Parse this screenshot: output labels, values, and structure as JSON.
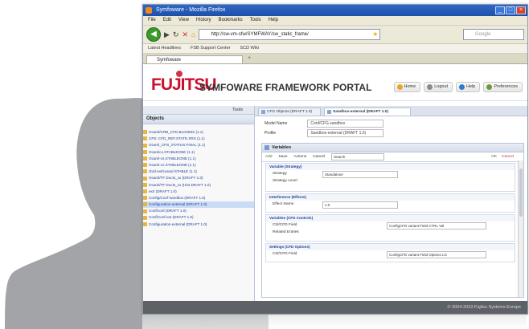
{
  "browser": {
    "title": "Symfoware - Mozilla Firefox",
    "menu": [
      "File",
      "Edit",
      "View",
      "History",
      "Bookmarks",
      "Tools",
      "Help"
    ],
    "url": "http://sw-vm-sfw/SYMFWAY/sw_static_frame/",
    "search_placeholder": "Google",
    "bookmarks": [
      "Latest Headlines",
      "FSB Support Center",
      "SCD Wiki"
    ],
    "tab_label": "Symfoware",
    "new_tab": "+"
  },
  "header": {
    "logo_text": "FUJITSU",
    "portal_title": "SYMFOWARE FRAMEWORK PORTAL",
    "actions": [
      "Home",
      "Logout",
      "Help",
      "Preferences"
    ],
    "action_colors": [
      "#e6a824",
      "#8a8a8a",
      "#2e7bd1",
      "#6a9a3a"
    ]
  },
  "left": {
    "head": "Tools",
    "section": "Objects",
    "tree": [
      "Ocaml/CRB_CFD.BLOOMS (1.1)",
      "CPS: CFD_REF.STATE.SRS (1.1)",
      "Ocaml_CPS_STATUS.FINAL (1.1)",
      "Ocamlcx.STABLEONE (1.1)",
      "Ocaml-cs.STABLEONE (1.1)",
      "Ocaml-cx.STABLEONE (1.1)",
      "cb/d-ext/cusval STABLE (1.1)",
      "Ocaml/TF Ducts_cx (DRAFT 1.0)",
      "Ocaml/TF Ducts_cx (Hint DRAFT 1.0)",
      "ext/ (DRAFT 1.0)",
      "Config/Conf-sandbox (DRAFT 1.0)",
      "Configuration-external (DRAFT 1.0)",
      "Conf/conf (DRAFT 1.0)",
      "Conf/Conf-ext (DRAFT 1.0)",
      "Configuration-external (DRAFT 1.0)"
    ],
    "selected_index": 11
  },
  "main": {
    "tabs": [
      "CFG Objects (DRAFT 1.0)",
      "Sandbox-external (DRAFT 1.0)"
    ],
    "fields": [
      {
        "label": "Model Name",
        "value": "Conf/CFG sandbox"
      },
      {
        "label": "Profile",
        "value": "Sandbox-external (DRAFT 1.0)"
      }
    ],
    "panel_title": "Variables",
    "toolbar": [
      "Add",
      "Save",
      "Actions",
      "Cancel"
    ],
    "toolbar_search": "Search",
    "toolbar_right": [
      "OK",
      "Cancel"
    ],
    "sections": [
      {
        "title": "Variable (Strategy)",
        "rows": [
          {
            "label": "Strategy",
            "value": "Standalone"
          },
          {
            "label": "Strategy Level",
            "value": ""
          }
        ]
      },
      {
        "title": "Interference (Effects)",
        "rows": [
          {
            "label": "Effect Name",
            "value": "1.0"
          }
        ]
      },
      {
        "title": "Variables (CFD Controls)",
        "rows": [
          {
            "label": "Ctrl/CFD Field",
            "value": "",
            "extra": "ConfigCFD variant Field CTRL Val"
          },
          {
            "label": "Related Entries",
            "value": ""
          }
        ]
      },
      {
        "title": "Settings (CFD Options)",
        "rows": [
          {
            "label": "Ctrl/CFD Field",
            "value": "",
            "extra": "ConfigCFD variant Field Options LG"
          }
        ]
      }
    ]
  },
  "footer": {
    "copyright": "© 2004-2010 Fujitsu Systems Europe"
  }
}
